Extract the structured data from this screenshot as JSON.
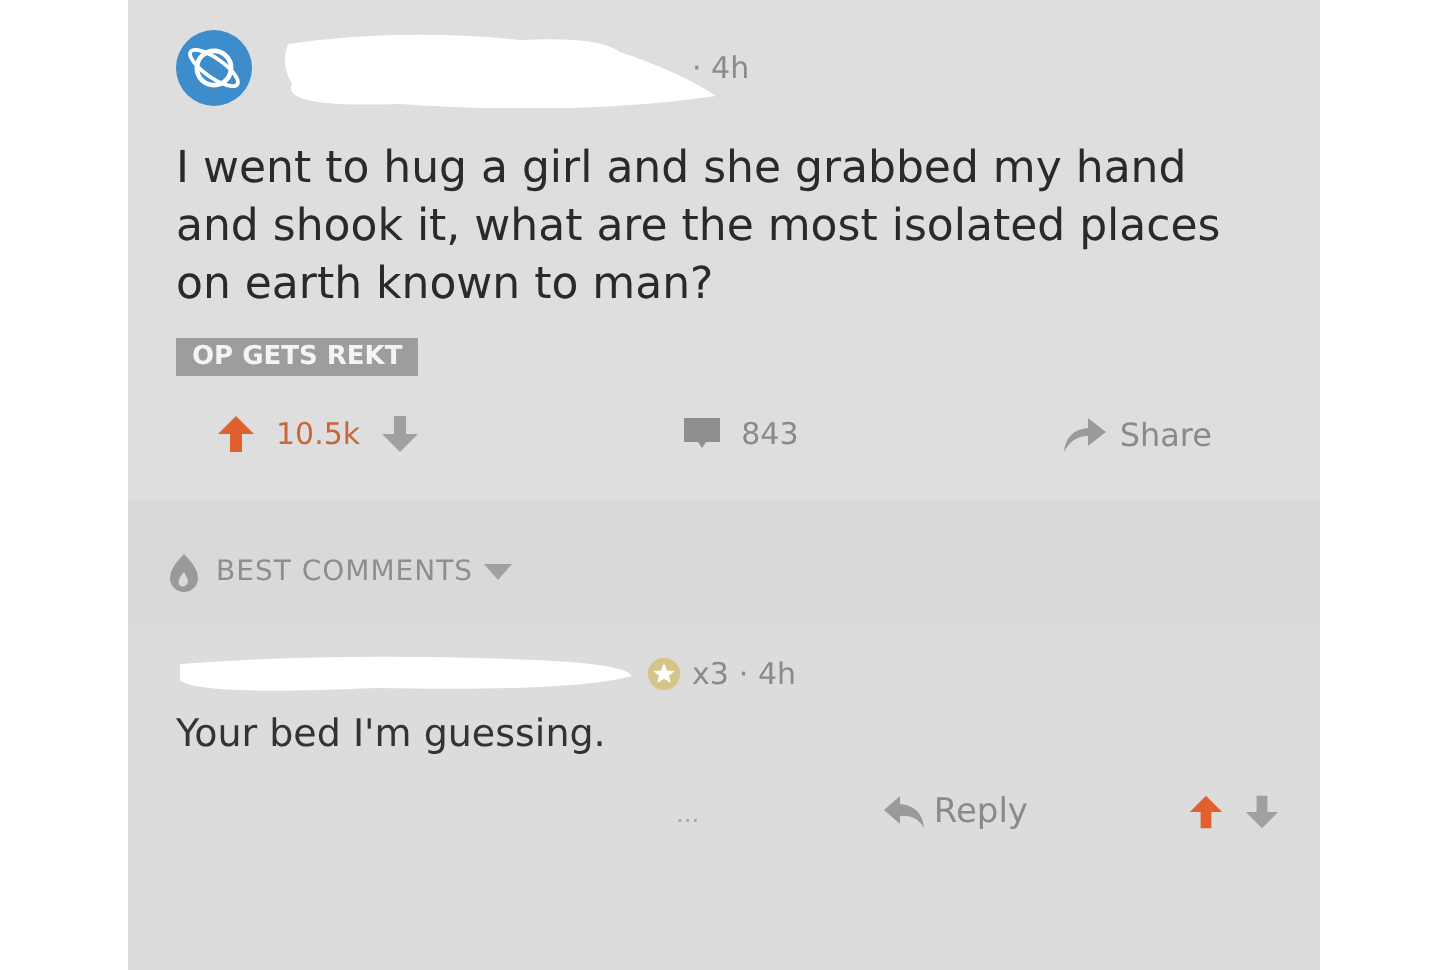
{
  "post": {
    "time": "· 4h",
    "title": "I went to hug a girl and she grabbed my hand and shook it, what are the most isolated places on earth known to man?",
    "flair": "OP GETS REKT",
    "score": "10.5k",
    "upvoted": true,
    "comments": "843",
    "share": "Share"
  },
  "sort": {
    "label": "BEST COMMENTS"
  },
  "comment": {
    "awards": "x3",
    "time": "· 4h",
    "body": "Your bed I'm guessing.",
    "more": "...",
    "reply": "Reply"
  }
}
